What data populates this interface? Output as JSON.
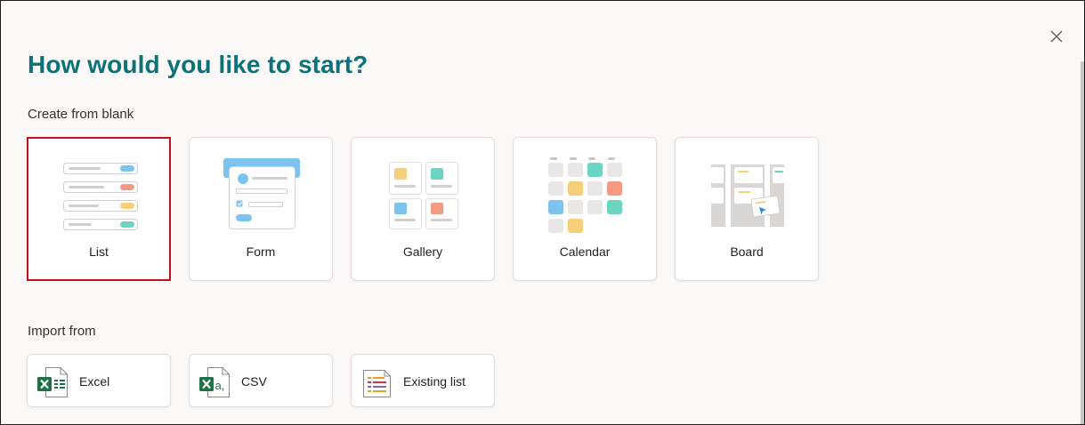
{
  "dialog": {
    "title": "How would you like to start?",
    "close_icon": "close-icon"
  },
  "create_section": {
    "heading": "Create from blank",
    "cards": [
      {
        "label": "List",
        "icon": "list-illustration",
        "selected": true
      },
      {
        "label": "Form",
        "icon": "form-illustration"
      },
      {
        "label": "Gallery",
        "icon": "gallery-illustration"
      },
      {
        "label": "Calendar",
        "icon": "calendar-illustration"
      },
      {
        "label": "Board",
        "icon": "board-illustration"
      }
    ]
  },
  "import_section": {
    "heading": "Import from",
    "cards": [
      {
        "label": "Excel",
        "icon": "excel-icon"
      },
      {
        "label": "CSV",
        "icon": "csv-icon"
      },
      {
        "label": "Existing list",
        "icon": "existing-list-icon"
      }
    ]
  },
  "colors": {
    "title": "#0a7278",
    "selected_border": "#c50f1f",
    "blue": "#7cc3f0",
    "orange": "#f39a82",
    "yellow": "#f5cf7a",
    "teal": "#6ad6c2",
    "excel_green": "#1d7245"
  }
}
